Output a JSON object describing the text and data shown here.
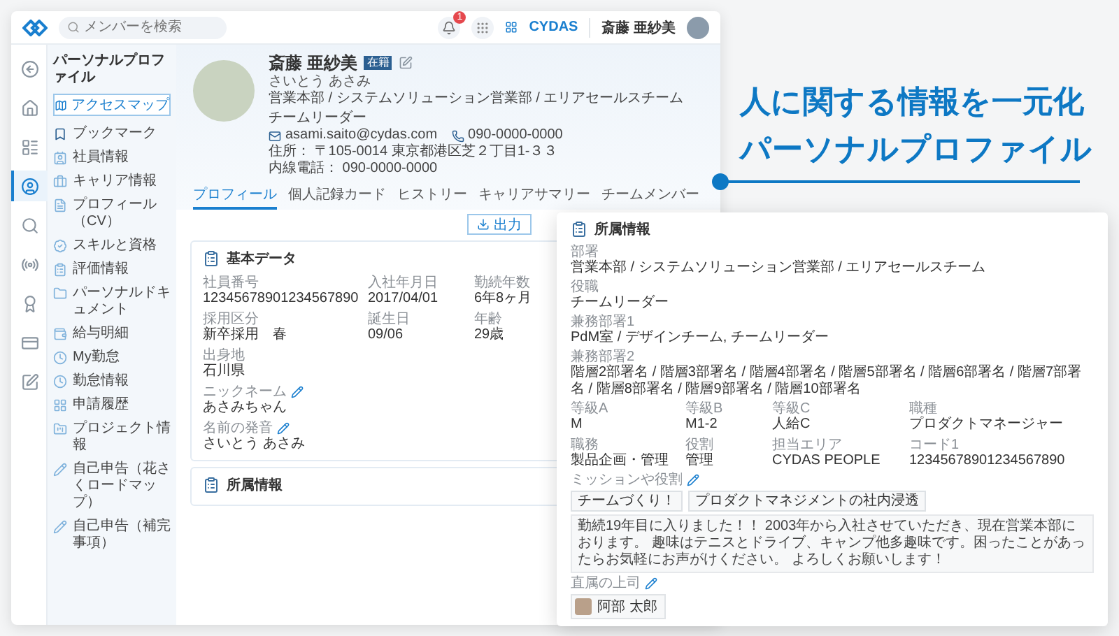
{
  "header": {
    "search": {
      "placeholder": "メンバーを検索"
    },
    "notification_badge": "1",
    "brand": "CYDAS",
    "user_name": "斎藤 亜紗美"
  },
  "nav_rail": [
    {
      "selected": false
    },
    {
      "selected": false
    },
    {
      "selected": false
    },
    {
      "selected": true
    },
    {
      "selected": false
    },
    {
      "selected": false
    },
    {
      "selected": false
    },
    {
      "selected": false
    },
    {
      "selected": false
    }
  ],
  "sidebar": {
    "title": "パーソナルプロファイル",
    "access_map_button": "アクセスマップ",
    "items": [
      {
        "label": "ブックマーク"
      },
      {
        "label": "社員情報"
      },
      {
        "label": "キャリア情報"
      },
      {
        "label": "プロフィール（CV）"
      },
      {
        "label": "スキルと資格"
      },
      {
        "label": "評価情報"
      },
      {
        "label": "パーソナルドキュメント"
      },
      {
        "label": "給与明細"
      },
      {
        "label": "My勤怠"
      },
      {
        "label": "勤怠情報"
      },
      {
        "label": "申請履歴"
      },
      {
        "label": "プロジェクト情報"
      },
      {
        "label": "自己申告（花さくロードマップ）"
      },
      {
        "label": "自己申告（補完事項）"
      }
    ]
  },
  "profile": {
    "name": "斎藤 亜紗美",
    "status_badge": "在籍",
    "kana": "さいとう あさみ",
    "affiliation": "営業本部 / システムソリューション営業部 / エリアセールスチーム",
    "position": "チームリーダー",
    "email": "asami.saito@cydas.com",
    "phone": "090-0000-0000",
    "address": "住所： 〒105-0014 東京都港区芝２丁目1-３３",
    "extension": "内線電話： 090-0000-0000"
  },
  "tabs": [
    {
      "label": "プロフィール",
      "selected": true
    },
    {
      "label": "個人記録カード",
      "selected": false
    },
    {
      "label": "ヒストリー",
      "selected": false
    },
    {
      "label": "キャリアサマリー",
      "selected": false
    },
    {
      "label": "チームメンバー",
      "selected": false
    }
  ],
  "export_button": "出力",
  "basic_data": {
    "title": "基本データ",
    "grid_fields": [
      {
        "label": "社員番号",
        "value": "12345678901234567890"
      },
      {
        "label": "入社年月日",
        "value": "2017/04/01"
      },
      {
        "label": "勤続年数",
        "value": "6年8ヶ月"
      },
      {
        "label": "採用区分",
        "value": "新卒採用　春"
      },
      {
        "label": "誕生日",
        "value": "09/06"
      },
      {
        "label": "年齢",
        "value": "29歳"
      },
      {
        "label": "出身地",
        "value": "石川県"
      }
    ],
    "fields": [
      {
        "label": "ニックネーム",
        "value": "あさみちゃん",
        "editable": true
      },
      {
        "label": "名前の発音",
        "value": "さいとう あさみ",
        "editable": true
      }
    ]
  },
  "affiliation_behind": {
    "title": "所属情報"
  },
  "tagline": [
    "人に関する情報を一元化",
    "パーソナルプロファイル"
  ],
  "affiliation_detail": {
    "title": "所属情報",
    "fields": [
      {
        "label": "部署",
        "value": "営業本部 / システムソリューション営業部 / エリアセールスチーム"
      },
      {
        "label": "役職",
        "value": "チームリーダー"
      },
      {
        "label": "兼務部署1",
        "value": "PdM室 / デザインチーム, チームリーダー"
      },
      {
        "label": "兼務部署2",
        "value": "階層2部署名 / 階層3部署名 / 階層4部署名 / 階層5部署名 / 階層6部署名 / 階層7部署名 / 階層8部署名 / 階層9部署名 / 階層10部署名"
      }
    ],
    "grid_fields": [
      {
        "label": "等級A",
        "value": "M"
      },
      {
        "label": "等級B",
        "value": "M1-2"
      },
      {
        "label": "等級C",
        "value": "人給C"
      },
      {
        "label": "職種",
        "value": "プロダクトマネージャー"
      },
      {
        "label": "職務",
        "value": "製品企画・管理"
      },
      {
        "label": "役割",
        "value": "管理"
      },
      {
        "label": "担当エリア",
        "value": "CYDAS PEOPLE"
      },
      {
        "label": "コード1",
        "value": "12345678901234567890"
      }
    ],
    "mission": {
      "label": "ミッションや役割",
      "editable": true,
      "tags": [
        "チームづくり！",
        "プロダクトマネジメントの社内浸透"
      ],
      "message": "勤続19年目に入りました！！ 2003年から入社させていただき、現在営業本部におります。 趣味はテニスとドライブ、キャンプ他多趣味です。困ったことがあったらお気軽にお声がけください。 よろしくお願いします！"
    },
    "supervisor": {
      "label": "直属の上司",
      "editable": true,
      "name": "阿部 太郎"
    }
  }
}
